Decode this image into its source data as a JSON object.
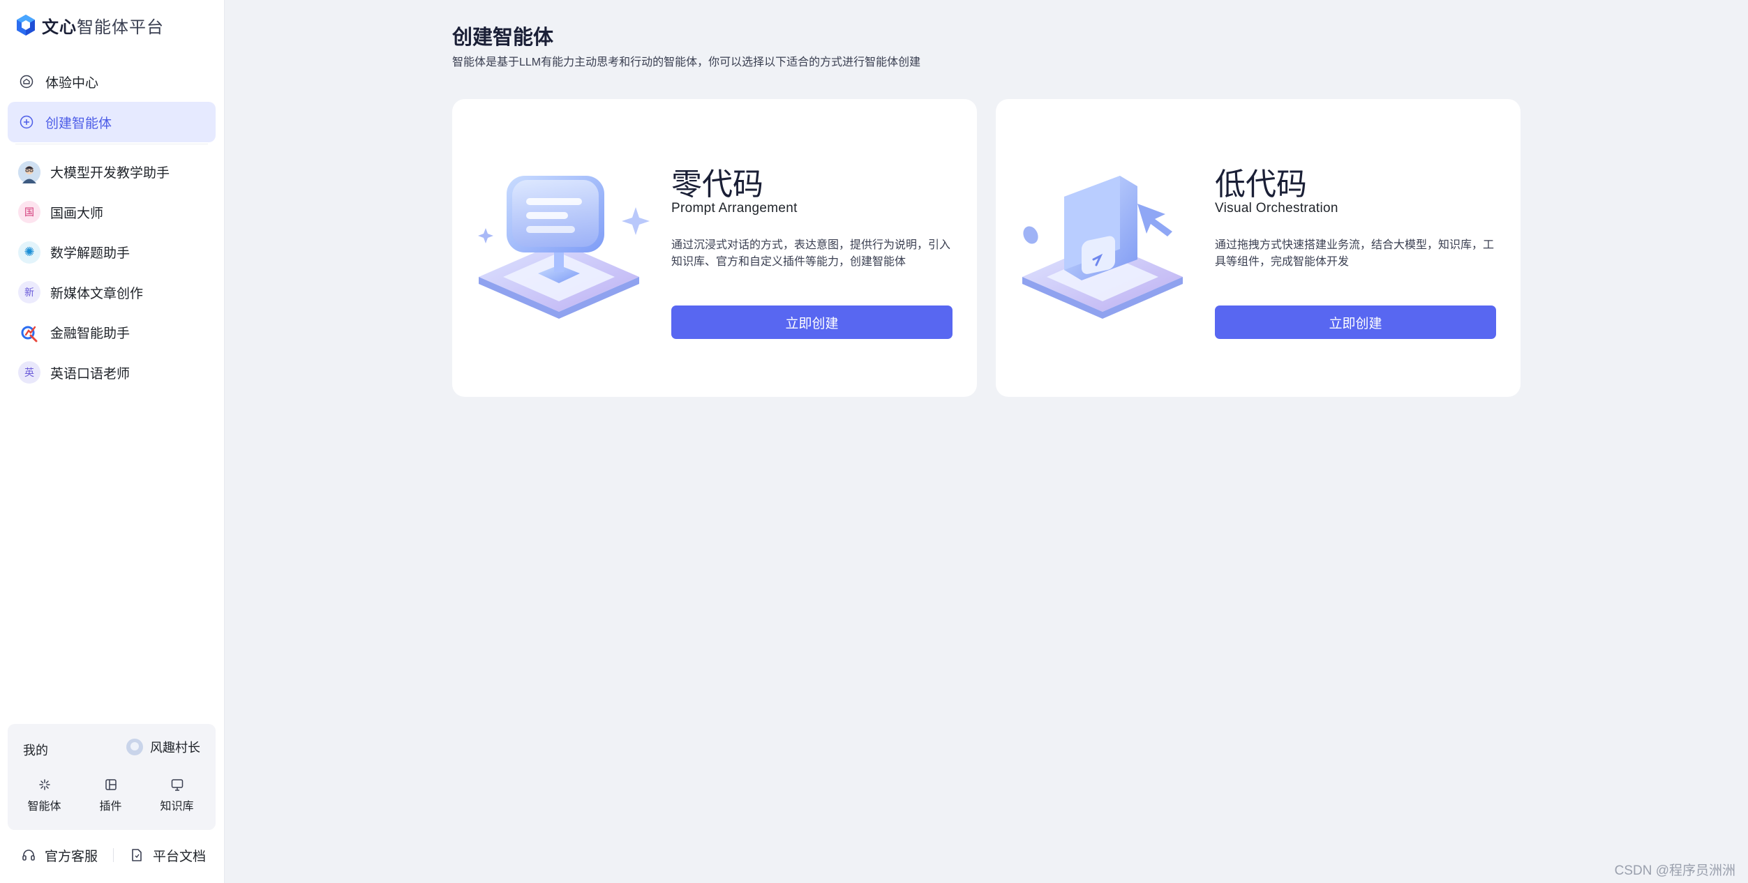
{
  "brand": {
    "bold": "文心",
    "rest": "智能体平台"
  },
  "nav": [
    {
      "label": "体验中心",
      "icon": "home-icon"
    },
    {
      "label": "创建智能体",
      "icon": "plus-circle-icon",
      "active": true
    }
  ],
  "agents": [
    {
      "label": "大模型开发教学助手",
      "avatar": "teacher-avatar",
      "glyph": "",
      "color": "#cfe0f2"
    },
    {
      "label": "国画大师",
      "avatar": "guohua-avatar",
      "glyph": "国",
      "color": "#fde4ef",
      "fg": "#d23b7a"
    },
    {
      "label": "数学解题助手",
      "avatar": "math-avatar",
      "glyph": "✺",
      "color": "#e3f4fb",
      "fg": "#1c8fd6"
    },
    {
      "label": "新媒体文章创作",
      "avatar": "media-avatar",
      "glyph": "新",
      "color": "#ecebfd",
      "fg": "#6a5bd9"
    },
    {
      "label": "金融智能助手",
      "avatar": "finance-avatar",
      "glyph": "",
      "color": "#ffffff"
    },
    {
      "label": "英语口语老师",
      "avatar": "english-avatar",
      "glyph": "英",
      "color": "#e9e8fb",
      "fg": "#6a5bd9"
    }
  ],
  "mine": {
    "title": "我的",
    "user": "风趣村长",
    "tools": [
      {
        "label": "智能体",
        "icon": "sparkle-icon"
      },
      {
        "label": "插件",
        "icon": "plugin-icon"
      },
      {
        "label": "知识库",
        "icon": "knowledge-icon"
      }
    ]
  },
  "footer": {
    "service": "官方客服",
    "docs": "平台文档"
  },
  "main": {
    "title": "创建智能体",
    "subtitle": "智能体是基于LLM有能力主动思考和行动的智能体，你可以选择以下适合的方式进行智能体创建"
  },
  "cards": [
    {
      "title": "零代码",
      "subtitle": "Prompt Arrangement",
      "desc": "通过沉浸式对话的方式，表达意图，提供行为说明，引入知识库、官方和自定义插件等能力，创建智能体",
      "button": "立即创建",
      "illustration": "chat-bubble-illustration"
    },
    {
      "title": "低代码",
      "subtitle": "Visual Orchestration",
      "desc": "通过拖拽方式快速搭建业务流，结合大模型，知识库，工具等组件，完成智能体开发",
      "button": "立即创建",
      "illustration": "canvas-cursor-illustration"
    }
  ],
  "watermark": "CSDN @程序员洲洲",
  "colors": {
    "accent": "#5867f1",
    "active_bg": "#e6eaff",
    "page_bg": "#f0f2f6"
  }
}
